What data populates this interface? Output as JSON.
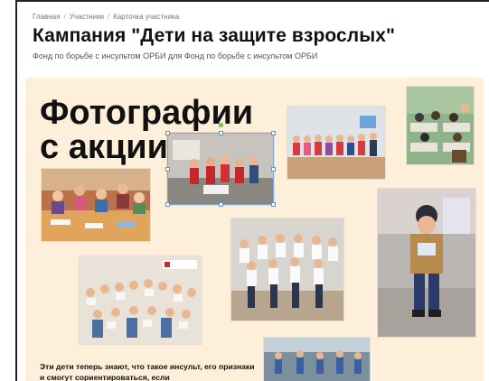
{
  "breadcrumb": {
    "items": [
      "Главная",
      "Участники",
      "Карточка участника"
    ]
  },
  "page": {
    "title": "Кампания \"Дети на защите взрослых\"",
    "subtitle": "Фонд по борьбе с инсультом ОРБИ для Фонд по борьбе с инсультом ОРБИ"
  },
  "poster": {
    "heading": "Фотографии с акции",
    "body_text": "Эти дети теперь знают, что такое инсульт, его признаки и смогут сориентироваться, если",
    "background": "#fdefd9"
  },
  "colors": {
    "poster_bg": "#fdefd9",
    "selection": "#7fa7d8",
    "rotate_handle": "#8bd36a"
  }
}
